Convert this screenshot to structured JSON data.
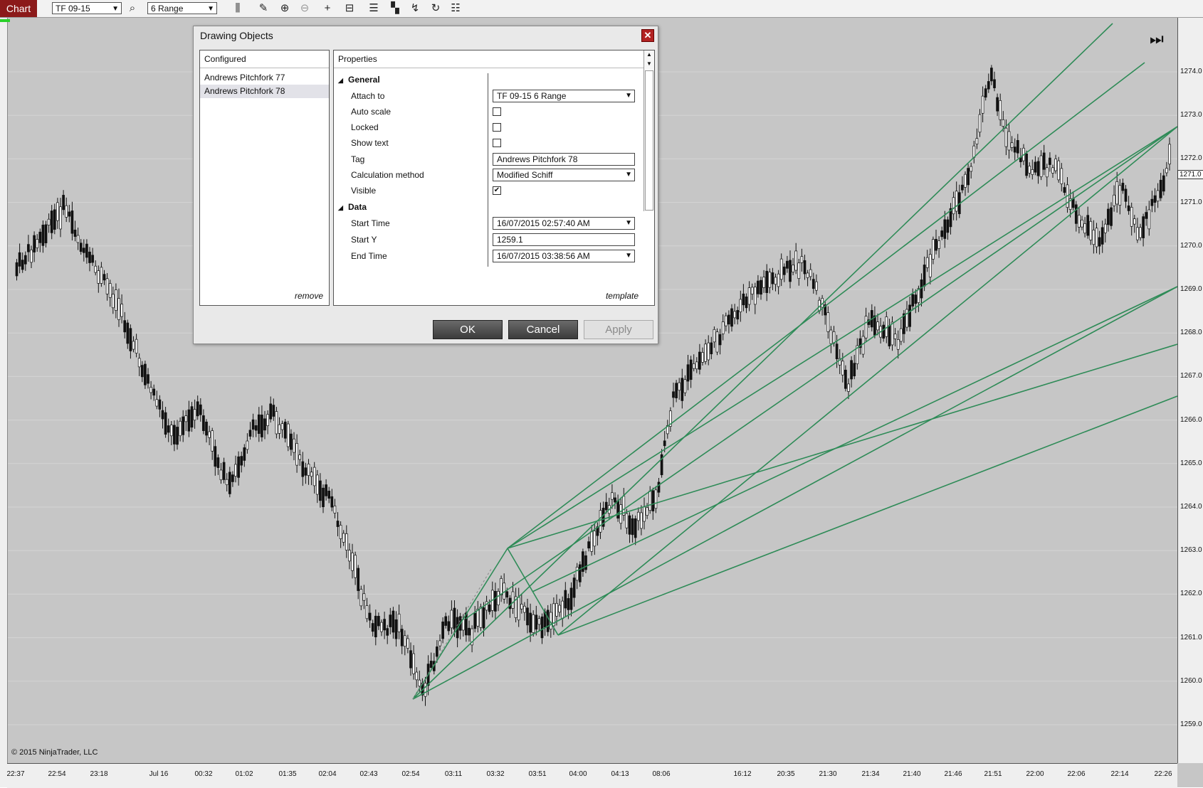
{
  "toolbar": {
    "chart_label": "Chart",
    "instrument": "TF 09-15",
    "period": "6 Range",
    "icons": [
      "search-icon",
      "bar-type-icon",
      "pencil-icon",
      "zoom-in-icon",
      "zoom-out-icon",
      "crosshair-icon",
      "data-box-icon",
      "chart-trader-icon",
      "indicators-icon",
      "strategies-icon",
      "refresh-icon",
      "properties-icon"
    ]
  },
  "chart": {
    "copyright": "© 2015 NinjaTrader, LLC",
    "price_labels": [
      "1274.0",
      "1273.0",
      "1272.0",
      "1271.0",
      "1270.0",
      "1269.0",
      "1268.0",
      "1267.0",
      "1266.0",
      "1265.0",
      "1264.0",
      "1263.0",
      "1262.0",
      "1261.0",
      "1260.0",
      "1259.0"
    ],
    "current_price_label": "1271.0",
    "time_labels": [
      "22:37",
      "22:54",
      "23:18",
      "Jul 16",
      "00:32",
      "01:02",
      "01:35",
      "02:04",
      "02:43",
      "02:54",
      "03:11",
      "03:32",
      "03:51",
      "04:00",
      "04:13",
      "08:06",
      "16:12",
      "20:35",
      "21:30",
      "21:34",
      "21:40",
      "21:46",
      "21:51",
      "22:00",
      "22:06",
      "22:14",
      "22:26"
    ],
    "colors": {
      "background": "#c6c6c6",
      "grid": "#d4d4d4",
      "pitchfork": "#2e8b57",
      "candle": "#111111"
    }
  },
  "dialog": {
    "title": "Drawing Objects",
    "configured_header": "Configured",
    "configured_items": [
      "Andrews Pitchfork 77",
      "Andrews Pitchfork 78"
    ],
    "remove_label": "remove",
    "properties_header": "Properties",
    "sections": {
      "general": "General",
      "data": "Data"
    },
    "props": {
      "attach_to": {
        "label": "Attach to",
        "value": "TF 09-15 6 Range"
      },
      "auto_scale": {
        "label": "Auto scale",
        "checked": false
      },
      "locked": {
        "label": "Locked",
        "checked": false
      },
      "show_text": {
        "label": "Show text",
        "checked": false
      },
      "tag": {
        "label": "Tag",
        "value": "Andrews Pitchfork 78"
      },
      "calc_method": {
        "label": "Calculation method",
        "value": "Modified Schiff"
      },
      "visible": {
        "label": "Visible",
        "checked": true
      },
      "start_time": {
        "label": "Start Time",
        "value": "16/07/2015 02:57:40 AM"
      },
      "start_y": {
        "label": "Start Y",
        "value": "1259.1"
      },
      "end_time": {
        "label": "End Time",
        "value": "16/07/2015 03:38:56 AM"
      }
    },
    "template_label": "template",
    "buttons": {
      "ok": "OK",
      "cancel": "Cancel",
      "apply": "Apply"
    }
  }
}
